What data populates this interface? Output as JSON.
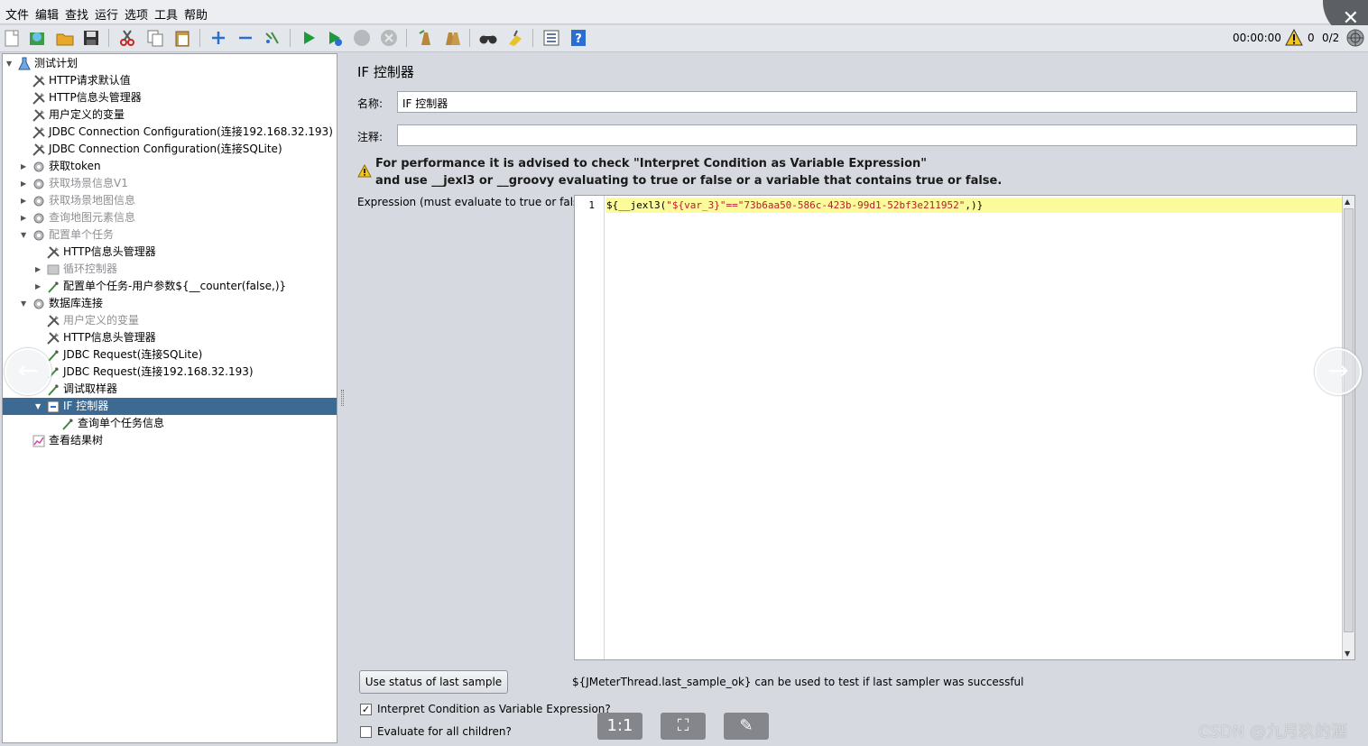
{
  "menu": [
    "文件",
    "编辑",
    "查找",
    "运行",
    "选项",
    "工具",
    "帮助"
  ],
  "toolbar": {
    "icons": [
      "new-icon",
      "templates-icon",
      "open-icon",
      "save-icon",
      "cut-icon",
      "copy-icon",
      "paste-icon",
      "expand-icon",
      "collapse-icon",
      "toggle-icon",
      "start-icon",
      "start-no-pause-icon",
      "stop-icon",
      "shutdown-icon",
      "clear-icon",
      "clear-all-icon",
      "search-icon",
      "reset-search-icon",
      "function-helper-icon",
      "help-icon"
    ],
    "timer": "00:00:00",
    "warn_count": "0",
    "threads": "0/2"
  },
  "tree": [
    {
      "label": "测试计划",
      "icon": "test-plan-icon",
      "state": "expanded",
      "disabled": false
    },
    {
      "label": "HTTP请求默认值",
      "icon": "config-element-icon",
      "state": "leaf",
      "disabled": false
    },
    {
      "label": "HTTP信息头管理器",
      "icon": "config-element-icon",
      "state": "leaf",
      "disabled": false
    },
    {
      "label": "用户定义的变量",
      "icon": "config-element-icon",
      "state": "leaf",
      "disabled": false
    },
    {
      "label": "JDBC Connection Configuration(连接192.168.32.193)",
      "icon": "config-element-icon",
      "state": "leaf",
      "disabled": false
    },
    {
      "label": "JDBC Connection Configuration(连接SQLite)",
      "icon": "config-element-icon",
      "state": "leaf",
      "disabled": false
    },
    {
      "label": "获取token",
      "icon": "thread-group-icon",
      "state": "collapsed",
      "disabled": false
    },
    {
      "label": "获取场景信息V1",
      "icon": "thread-group-icon",
      "state": "collapsed",
      "disabled": true
    },
    {
      "label": "获取场景地图信息",
      "icon": "thread-group-icon",
      "state": "collapsed",
      "disabled": true
    },
    {
      "label": "查询地图元素信息",
      "icon": "thread-group-icon",
      "state": "collapsed",
      "disabled": true
    },
    {
      "label": "配置单个任务",
      "icon": "thread-group-icon",
      "state": "expanded",
      "disabled": true
    },
    {
      "label": "HTTP信息头管理器",
      "icon": "config-element-icon",
      "state": "leaf",
      "disabled": false
    },
    {
      "label": "循环控制器",
      "icon": "loop-controller-icon",
      "state": "collapsed",
      "disabled": true
    },
    {
      "label": "配置单个任务-用户参数${__counter(false,)}",
      "icon": "sampler-icon",
      "state": "collapsed",
      "disabled": false
    },
    {
      "label": "数据库连接",
      "icon": "thread-group-icon",
      "state": "expanded",
      "disabled": false
    },
    {
      "label": "用户定义的变量",
      "icon": "config-element-icon",
      "state": "leaf",
      "disabled": true
    },
    {
      "label": "HTTP信息头管理器",
      "icon": "config-element-icon",
      "state": "leaf",
      "disabled": false
    },
    {
      "label": "JDBC Request(连接SQLite)",
      "icon": "sampler-icon",
      "state": "leaf",
      "disabled": false
    },
    {
      "label": "JDBC Request(连接192.168.32.193)",
      "icon": "sampler-icon",
      "state": "leaf",
      "disabled": false
    },
    {
      "label": "调试取样器",
      "icon": "sampler-icon",
      "state": "leaf",
      "disabled": false
    },
    {
      "label": "IF 控制器",
      "icon": "if-controller-icon",
      "state": "expanded",
      "disabled": false,
      "selected": true
    },
    {
      "label": "查询单个任务信息",
      "icon": "sampler-icon",
      "state": "leaf",
      "disabled": false
    },
    {
      "label": "查看结果树",
      "icon": "listener-icon",
      "state": "leaf",
      "disabled": false
    }
  ],
  "panel": {
    "title": "IF 控制器",
    "name_label": "名称:",
    "name_value": "IF 控制器",
    "comment_label": "注释:",
    "comment_value": "",
    "warning_line1": "For performance it is advised to check \"Interpret Condition as Variable Expression\"",
    "warning_line2": "and use __jexl3 or __groovy evaluating to true or false or a variable that contains true or false.",
    "expr_label": "Expression (must evaluate to true or false)",
    "line_number": "1",
    "code_prefix": "${__jexl3(",
    "code_string": "\"${var_3}\"==\"73b6aa50-586c-423b-99d1-52bf3e211952\"",
    "code_suffix": ",)}",
    "use_status_button": "Use status of last sample",
    "hint": "${JMeterThread.last_sample_ok} can be used to test if last sampler was successful",
    "interpret_label": "Interpret Condition as Variable Expression?",
    "interpret_checked": true,
    "evaluate_label": "Evaluate for all children?",
    "evaluate_checked": false
  },
  "overlay": {
    "prev": "←",
    "next": "→",
    "btn_actual": "1:1",
    "btn_fit": "⛶",
    "btn_edit": "✎"
  },
  "watermark": "CSDN @九月玖的酒"
}
